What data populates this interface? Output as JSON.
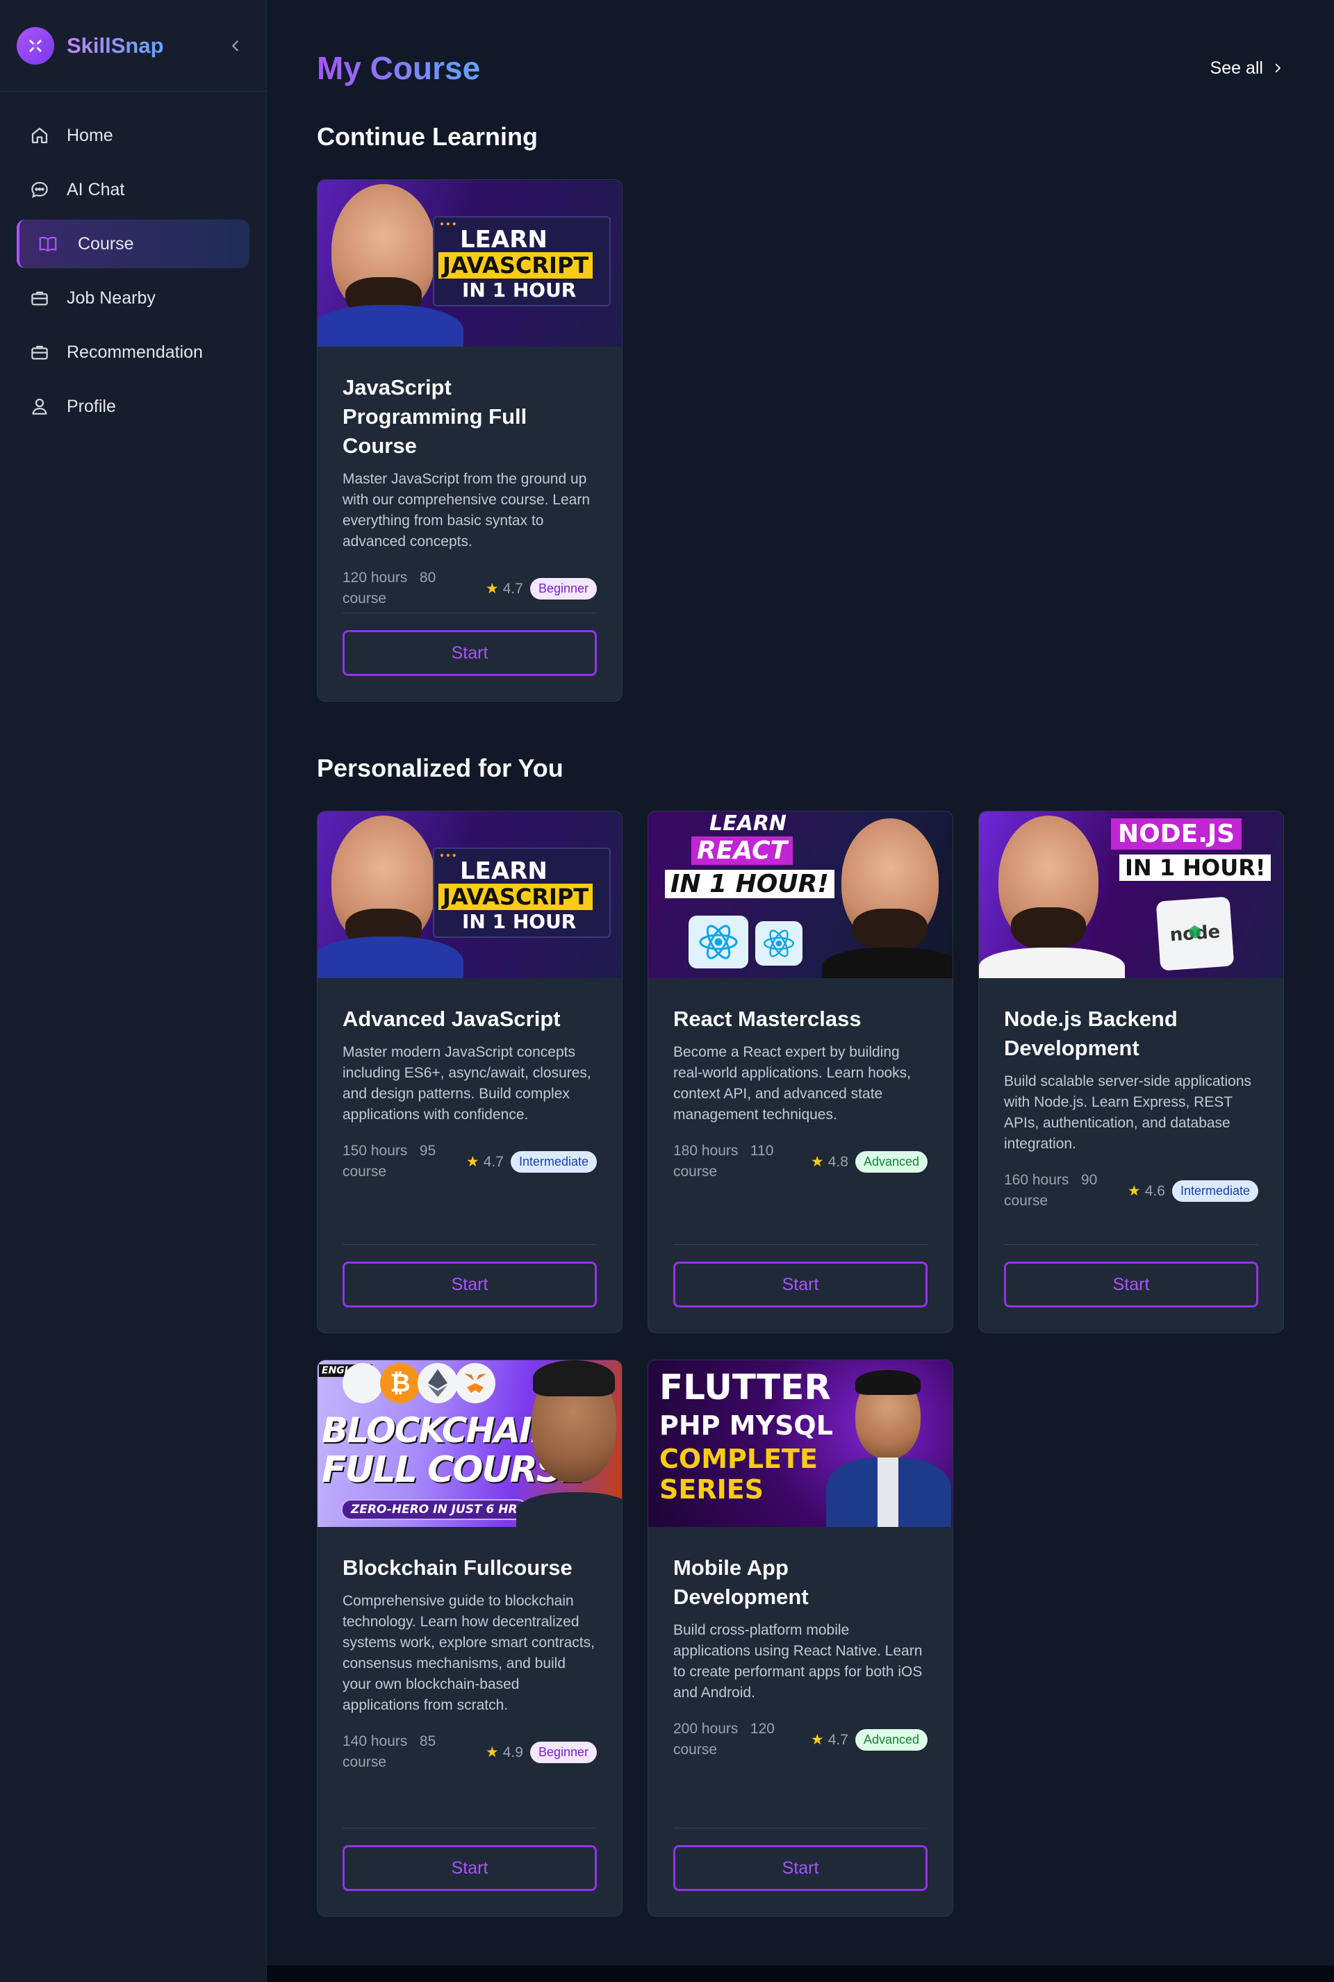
{
  "brand": {
    "name": "SkillSnap"
  },
  "sidebar": {
    "items": [
      {
        "label": "Home",
        "icon": "home-icon",
        "active": false
      },
      {
        "label": "AI Chat",
        "icon": "chat-icon",
        "active": false
      },
      {
        "label": "Course",
        "icon": "book-icon",
        "active": true
      },
      {
        "label": "Job Nearby",
        "icon": "briefcase-icon",
        "active": false
      },
      {
        "label": "Recommendation",
        "icon": "briefcase-icon",
        "active": false
      },
      {
        "label": "Profile",
        "icon": "user-icon",
        "active": false
      }
    ]
  },
  "header": {
    "title": "My Course",
    "see_all": "See all"
  },
  "continue": {
    "title": "Continue Learning",
    "cards": [
      {
        "title": "JavaScript Programming Full Course",
        "description": "Master JavaScript from the ground up with our comprehensive course. Learn everything from basic syntax to advanced concepts.",
        "hours": "120 hours",
        "courses": "80",
        "course_label": "course",
        "rating": "4.7",
        "level": "Beginner",
        "button": "Start",
        "thumb": {
          "line1": "LEARN",
          "line2": "JAVASCRIPT",
          "line3": "IN 1 HOUR"
        }
      }
    ]
  },
  "personalized": {
    "title": "Personalized for You",
    "cards": [
      {
        "title": "Advanced JavaScript",
        "description": "Master modern JavaScript concepts including ES6+, async/await, closures, and design patterns. Build complex applications with confidence.",
        "hours": "150 hours",
        "courses": "95",
        "course_label": "course",
        "rating": "4.7",
        "level": "Intermediate",
        "button": "Start",
        "thumb": {
          "line1": "LEARN",
          "line2": "JAVASCRIPT",
          "line3": "IN 1 HOUR"
        }
      },
      {
        "title": "React Masterclass",
        "description": "Become a React expert by building real-world applications. Learn hooks, context API, and advanced state management techniques.",
        "hours": "180 hours",
        "courses": "110",
        "course_label": "course",
        "rating": "4.8",
        "level": "Advanced",
        "button": "Start",
        "thumb": {
          "line1": "LEARN",
          "line2": "REACT",
          "line3": "IN 1 HOUR!"
        }
      },
      {
        "title": "Node.js Backend Development",
        "description": "Build scalable server-side applications with Node.js. Learn Express, REST APIs, authentication, and database integration.",
        "hours": "160 hours",
        "courses": "90",
        "course_label": "course",
        "rating": "4.6",
        "level": "Intermediate",
        "button": "Start",
        "thumb": {
          "line1": "NODE.JS",
          "line2": "IN 1 HOUR!",
          "logo": "node"
        }
      },
      {
        "title": "Blockchain Fullcourse",
        "description": "Comprehensive guide to blockchain technology. Learn how decentralized systems work, explore smart contracts, consensus mechanisms, and build your own blockchain-based applications from scratch.",
        "hours": "140 hours",
        "courses": "85",
        "course_label": "course",
        "rating": "4.9",
        "level": "Beginner",
        "button": "Start",
        "thumb": {
          "tag": "ENGLISH",
          "line1": "BLOCKCHAIN",
          "line2": "FULL COURSE",
          "line3": "ZERO-HERO IN JUST 6 HR"
        }
      },
      {
        "title": "Mobile App Development",
        "description": "Build cross-platform mobile applications using React Native. Learn to create performant apps for both iOS and Android.",
        "hours": "200 hours",
        "courses": "120",
        "course_label": "course",
        "rating": "4.7",
        "level": "Advanced",
        "button": "Start",
        "thumb": {
          "line1": "FLUTTER",
          "line2": "PHP MYSQL",
          "line3": "COMPLETE",
          "line4": "SERIES"
        }
      }
    ]
  },
  "colors": {
    "accent": "#a855f7",
    "background": "#111827",
    "card": "#1f2937",
    "sidebar": "#161e2e"
  }
}
